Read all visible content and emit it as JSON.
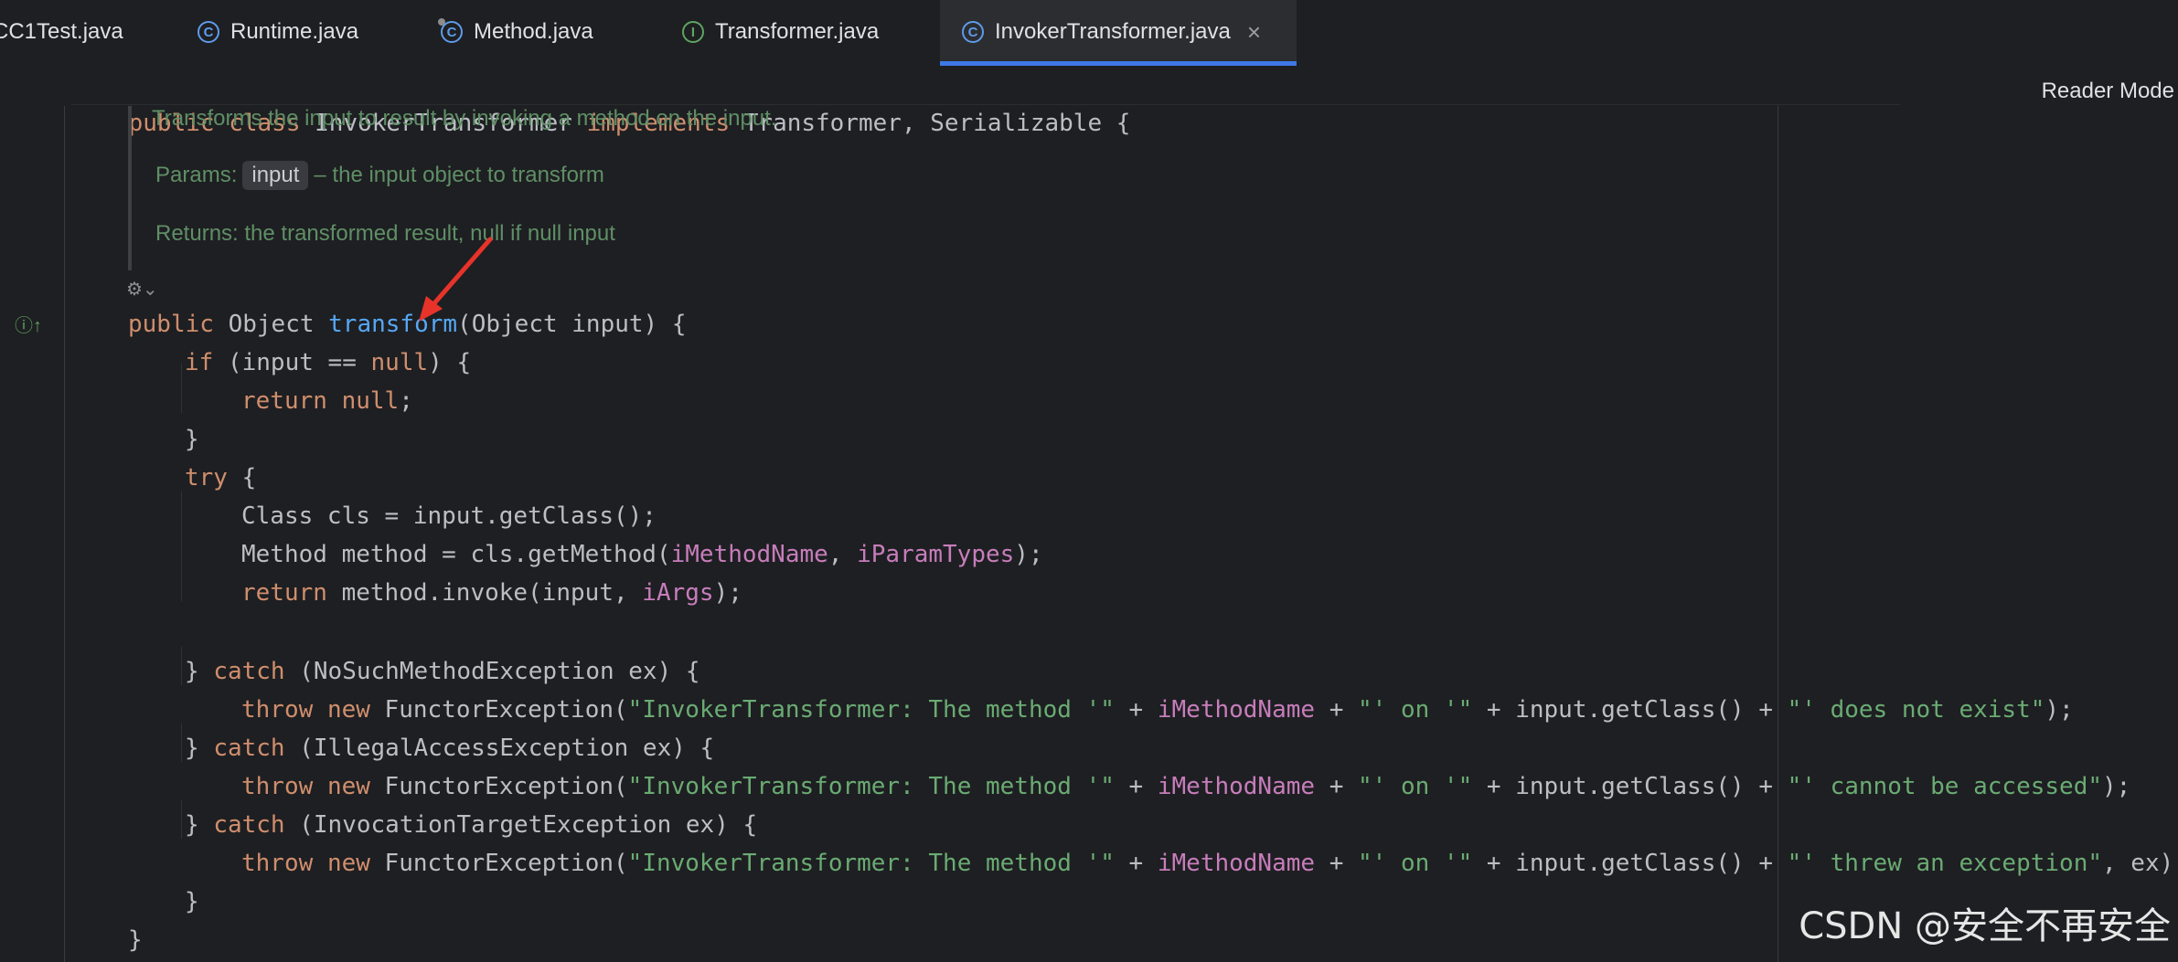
{
  "tabs": [
    {
      "label": "CC1Test.java",
      "icon": "none"
    },
    {
      "label": "Runtime.java",
      "icon": "class-icon"
    },
    {
      "label": "Method.java",
      "icon": "class-icon"
    },
    {
      "label": "Transformer.java",
      "icon": "interface-icon"
    },
    {
      "label": "InvokerTransformer.java",
      "icon": "class-icon",
      "active": true,
      "close": "×"
    }
  ],
  "reader_mode": "Reader Mode",
  "class_decl": {
    "public": "public",
    "class": "class",
    "name": "InvokerTransformer",
    "implements": "implements",
    "rest": "Transformer, Serializable {"
  },
  "doc": {
    "summary": "Transforms the input to result by invoking a method on the input.",
    "params_label": "Params:",
    "param_name": "input",
    "param_desc": "– the input object to transform",
    "returns": "Returns: the transformed result, null if null input"
  },
  "code": {
    "l1": {
      "kw": "public",
      "type": "Object",
      "fn": "transform",
      "rest": "(Object input) {"
    },
    "l2": {
      "kw": "if",
      "a": "(input == ",
      "kw2": "null",
      "b": ") {"
    },
    "l3": {
      "kw": "return",
      "kw2": "null",
      "b": ";"
    },
    "l4": "}",
    "l5": {
      "kw": "try",
      "b": " {"
    },
    "l6": "Class cls = input.getClass();",
    "l7": {
      "a": "Method method = cls.getMethod(",
      "f1": "iMethodName",
      "sep": ", ",
      "f2": "iParamTypes",
      "b": ");"
    },
    "l8": {
      "kw": "return",
      "a": " method.invoke(input, ",
      "f1": "iArgs",
      "b": ");"
    },
    "c1": {
      "a": "} ",
      "kw": "catch",
      "b": " (NoSuchMethodException ex) {"
    },
    "t1": {
      "kw": "throw",
      "kw2": "new",
      "a": " FunctorException(",
      "s1": "\"InvokerTransformer: The method '\"",
      "p1": " + ",
      "f1": "iMethodName",
      "p2": " + ",
      "s2": "\"' on '\"",
      "p3": " + input.getClass() + ",
      "s3": "\"' does not exist\"",
      "b": ");"
    },
    "c2": {
      "a": "} ",
      "kw": "catch",
      "b": " (IllegalAccessException ex) {"
    },
    "t2": {
      "kw": "throw",
      "kw2": "new",
      "a": " FunctorException(",
      "s1": "\"InvokerTransformer: The method '\"",
      "p1": " + ",
      "f1": "iMethodName",
      "p2": " + ",
      "s2": "\"' on '\"",
      "p3": " + input.getClass() + ",
      "s3": "\"' cannot be accessed\"",
      "b": ");"
    },
    "c3": {
      "a": "} ",
      "kw": "catch",
      "b": " (InvocationTargetException ex) {"
    },
    "t3": {
      "kw": "throw",
      "kw2": "new",
      "a": " FunctorException(",
      "s1": "\"InvokerTransformer: The method '\"",
      "p1": " + ",
      "f1": "iMethodName",
      "p2": " + ",
      "s2": "\"' on '\"",
      "p3": " + input.getClass() + ",
      "s3": "\"' threw an exception\"",
      "b": ", ex);"
    },
    "close_inner": "}",
    "close_outer": "}"
  },
  "watermark": "CSDN @安全不再安全",
  "colors": {
    "keyword": "#cf8e6d",
    "method": "#56a8f5",
    "field": "#c77dbb",
    "string": "#6aab73",
    "doc": "#5f8f66",
    "arrow": "#e8332a",
    "accent": "#3d78e6"
  }
}
